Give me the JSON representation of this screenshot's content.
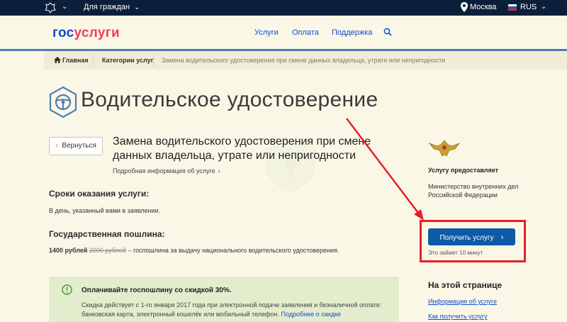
{
  "topbar": {
    "citizens": "Для граждан",
    "city": "Москва",
    "lang": "RUS"
  },
  "header": {
    "logo_gos": "гос",
    "logo_uslugi": "услуги",
    "nav": [
      "Услуги",
      "Оплата",
      "Поддержка"
    ]
  },
  "breadcrumb": {
    "home": "Главная",
    "categories": "Категории услуг",
    "current": "Замена водительского удостоверения при смене данных владельца, утрате или непригодности"
  },
  "page": {
    "title": "Водительское удостоверение",
    "back_label": "Вернуться",
    "service_title": "Замена водительского удостоверения при смене данных владельца, утрате или непригодности",
    "more_info": "Подробная информация об услуге",
    "terms_heading": "Сроки оказания услуги:",
    "terms_text": "В день, указанный вами в заявлении.",
    "fee_heading": "Государственная пошлина:",
    "fee_price": "1400 рублей",
    "fee_old_price": "2000 рублей",
    "fee_text": "– госпошлина за выдачу национального водительского удостоверения."
  },
  "discount": {
    "heading": "Оплачивайте госпошлину со скидкой 30%.",
    "body": "Скидка действует с 1-го января 2017 года при электронной подаче заявления и безналичной оплате: банковская карта, электронный кошелёк или мобильный телефон.",
    "link": "Подробнее о скидке"
  },
  "sidebar": {
    "provider_heading": "Услугу предоставляет",
    "provider_name": "Министерство внутренних дел Российской Федерации",
    "get_service": "Получить услугу",
    "duration": "Это займет 10 минут",
    "toc_heading": "На этой странице",
    "toc_links": [
      "Информация об услуге",
      "Как получить услугу"
    ]
  },
  "colors": {
    "brand_blue": "#0d4cd3",
    "brand_red": "#ee3f58",
    "button_blue": "#0d5aa7",
    "highlight_red": "#e3202a"
  }
}
